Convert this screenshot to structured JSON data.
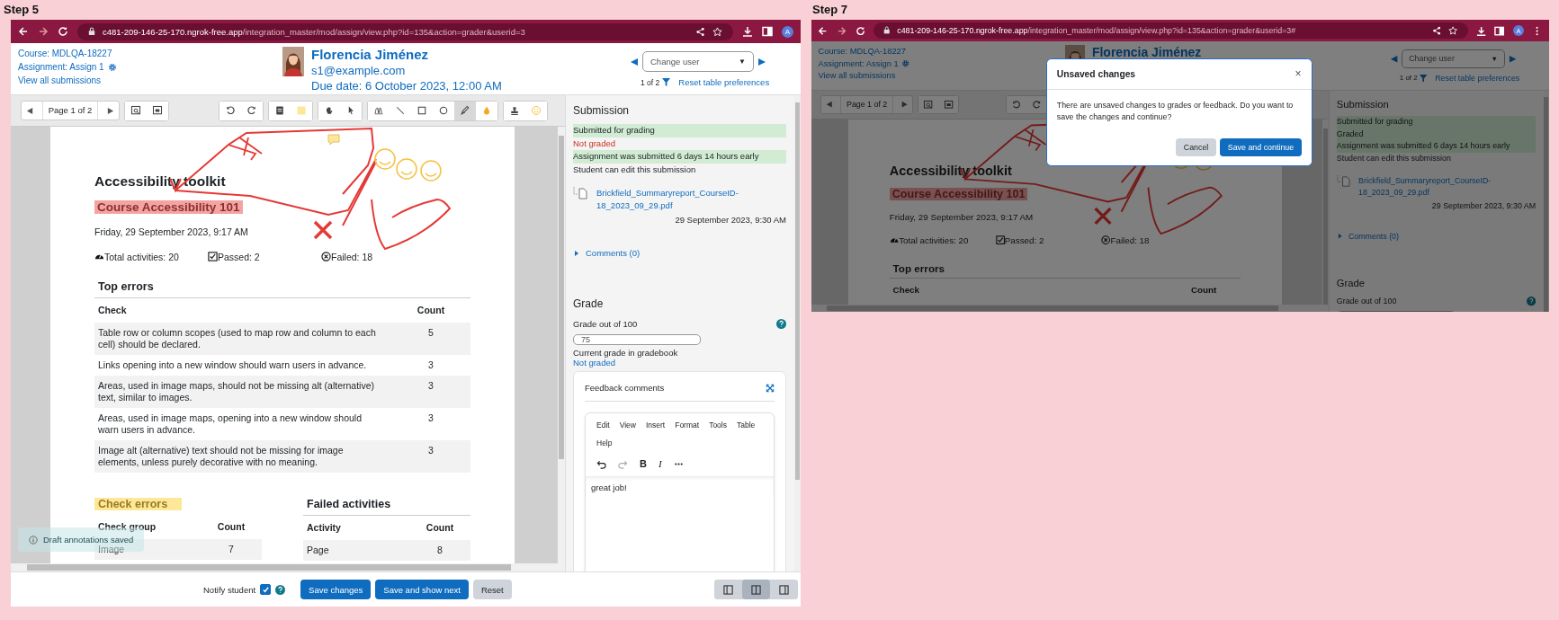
{
  "steps": [
    {
      "label": "Step 5",
      "browser": {
        "url_host": "c481-209-146-25-170.ngrok-free.app",
        "url_path": "/integration_master/mod/assign/view.php?id=135&action=grader&userid=3",
        "profile": "A",
        "menu": false
      },
      "header": {
        "course": "Course: MDLQA-18227",
        "assignment": "Assignment: Assign 1",
        "view_all": "View all submissions",
        "user": {
          "name": "Florencia Jiménez",
          "email": "s1@example.com",
          "due_date": "Due date: 6 October 2023, 12:00 AM"
        },
        "change_user": {
          "placeholder": "Change user",
          "caret": "▼"
        },
        "counter": "1 of 2",
        "reset": "Reset table preferences"
      },
      "toolbar": {
        "page": "Page 1 of 2",
        "groups": [
          [
            {
              "kind": "search-comments",
              "selected": false
            },
            {
              "kind": "expand-comments",
              "selected": false
            }
          ],
          [
            {
              "kind": "rotate-left",
              "selected": false
            },
            {
              "kind": "rotate-right",
              "selected": false
            }
          ],
          [
            {
              "kind": "comment",
              "selected": false
            },
            {
              "kind": "color-swatch",
              "selected": false
            }
          ],
          [
            {
              "kind": "hand",
              "selected": false
            },
            {
              "kind": "cursor",
              "selected": false
            }
          ],
          [
            {
              "kind": "highlighter",
              "selected": false
            },
            {
              "kind": "line",
              "selected": false
            },
            {
              "kind": "rectangle",
              "selected": false
            },
            {
              "kind": "oval",
              "selected": false
            },
            {
              "kind": "pen",
              "selected": true
            },
            {
              "kind": "drop",
              "selected": false
            }
          ],
          [
            {
              "kind": "stamp",
              "selected": false
            },
            {
              "kind": "smiley",
              "selected": false
            }
          ]
        ]
      },
      "document": {
        "title": "Accessibility toolkit",
        "course": "Course Accessibility 101",
        "date": "Friday, 29 September 2023, 9:17 AM",
        "stats": [
          {
            "kind": "total",
            "text": "Total activities: 20"
          },
          {
            "kind": "passed",
            "text": "Passed: 2"
          },
          {
            "kind": "failed",
            "text": "Failed: 18"
          }
        ],
        "top_errors": {
          "title": "Top errors",
          "columns": [
            "Check",
            "Count"
          ],
          "rows": [
            [
              "Table row or column scopes (used to map row and column to each cell) should be declared.",
              "5"
            ],
            [
              "Links opening into a new window should warn users in advance.",
              "3"
            ],
            [
              "Areas, used in image maps, should not be missing alt (alternative) text, similar to images.",
              "3"
            ],
            [
              "Areas, used in image maps, opening into a new window should warn users in advance.",
              "3"
            ],
            [
              "Image alt (alternative) text should not be missing for image elements, unless purely decorative with no meaning.",
              "3"
            ]
          ]
        },
        "check_errors": {
          "title": "Check errors",
          "columns": [
            "Check group",
            "Count"
          ],
          "rows": [
            [
              "Image",
              "7"
            ]
          ]
        },
        "failed_activities": {
          "title": "Failed activities",
          "columns": [
            "Activity",
            "Count"
          ],
          "rows": [
            [
              "Page",
              "8"
            ]
          ]
        }
      },
      "toast": {
        "text": "Draft annotations saved"
      },
      "submission": {
        "title": "Submission",
        "statuses": [
          {
            "kind": "success",
            "text": "Submitted for grading"
          },
          {
            "kind": "danger",
            "text": "Not graded"
          },
          {
            "kind": "success",
            "text": "Assignment was submitted 6 days 14 hours early"
          },
          {
            "kind": "plain",
            "text": "Student can edit this submission"
          }
        ],
        "file": {
          "name": "Brickfield_Summaryreport_CourseID-18_2023_09_29.pdf",
          "date": "29 September 2023, 9:30 AM"
        },
        "comments": "Comments (0)"
      },
      "grade": {
        "title": "Grade",
        "label": "Grade out of 100",
        "value": "75",
        "gradebook_label": "Current grade in gradebook",
        "gradebook_value": "Not graded"
      },
      "feedback": {
        "title": "Feedback comments",
        "menu": [
          "Edit",
          "View",
          "Insert",
          "Format",
          "Tools",
          "Table",
          "Help"
        ],
        "tools": [
          {
            "kind": "undo",
            "disabled": false
          },
          {
            "kind": "redo",
            "disabled": true
          },
          {
            "kind": "bold",
            "text": "B",
            "disabled": false
          },
          {
            "kind": "italic",
            "text": "I",
            "disabled": false
          },
          {
            "kind": "more",
            "disabled": false
          }
        ],
        "content": "great job!"
      },
      "footer": {
        "notify": {
          "label": "Notify student",
          "checked": true
        },
        "buttons": [
          {
            "kind": "primary",
            "label": "Save changes"
          },
          {
            "kind": "primary",
            "label": "Save and show next"
          },
          {
            "kind": "secondary",
            "label": "Reset"
          }
        ],
        "layouts": [
          {
            "kind": "left",
            "selected": false
          },
          {
            "kind": "both",
            "selected": true
          },
          {
            "kind": "right",
            "selected": false
          }
        ]
      }
    },
    {
      "label": "Step 7",
      "browser": {
        "url_host": "c481-209-146-25-170.ngrok-free.app",
        "url_path": "/integration_master/mod/assign/view.php?id=135&action=grader&userid=3#",
        "profile": "A",
        "menu": true
      },
      "header": {
        "course": "Course: MDLQA-18227",
        "assignment": "Assignment: Assign 1",
        "view_all": "View all submissions",
        "user": {
          "name": "Florencia Jiménez"
        },
        "change_user": {
          "placeholder": "Change user",
          "caret": "▼"
        },
        "counter": "1 of 2",
        "reset": "Reset table preferences"
      },
      "toolbar": {
        "page": "Page 1 of 2",
        "groups": [
          [
            {
              "kind": "search-comments",
              "selected": false
            },
            {
              "kind": "expand-comments",
              "selected": false
            }
          ],
          [
            {
              "kind": "rotate-left",
              "selected": false
            },
            {
              "kind": "rotate-right",
              "selected": false
            }
          ]
        ]
      },
      "document": {
        "title": "Accessibility toolkit",
        "course": "Course Accessibility 101",
        "date": "Friday, 29 September 2023, 9:17 AM",
        "stats": [
          {
            "kind": "total",
            "text": "Total activities: 20"
          },
          {
            "kind": "passed",
            "text": "Passed: 2"
          },
          {
            "kind": "failed",
            "text": "Failed: 18"
          }
        ],
        "top_errors": {
          "title": "Top errors",
          "columns": [
            "Check",
            "Count"
          ]
        }
      },
      "submission": {
        "title": "Submission",
        "statuses": [
          {
            "kind": "success",
            "text": "Submitted for grading"
          },
          {
            "kind": "success",
            "text": "Graded"
          },
          {
            "kind": "success",
            "text": "Assignment was submitted 6 days 14 hours early"
          },
          {
            "kind": "plain",
            "text": "Student can edit this submission"
          }
        ],
        "file": {
          "name": "Brickfield_Summaryreport_CourseID-18_2023_09_29.pdf",
          "date": "29 September 2023, 9:30 AM"
        },
        "comments": "Comments (0)"
      },
      "grade": {
        "title": "Grade",
        "label": "Grade out of 100"
      },
      "dialog": {
        "title": "Unsaved changes",
        "close": "×",
        "message": "There are unsaved changes to grades or feedback. Do you want to save the changes and continue?",
        "buttons": [
          {
            "kind": "secondary",
            "label": "Cancel"
          },
          {
            "kind": "primary",
            "label": "Save and continue"
          }
        ]
      }
    }
  ]
}
